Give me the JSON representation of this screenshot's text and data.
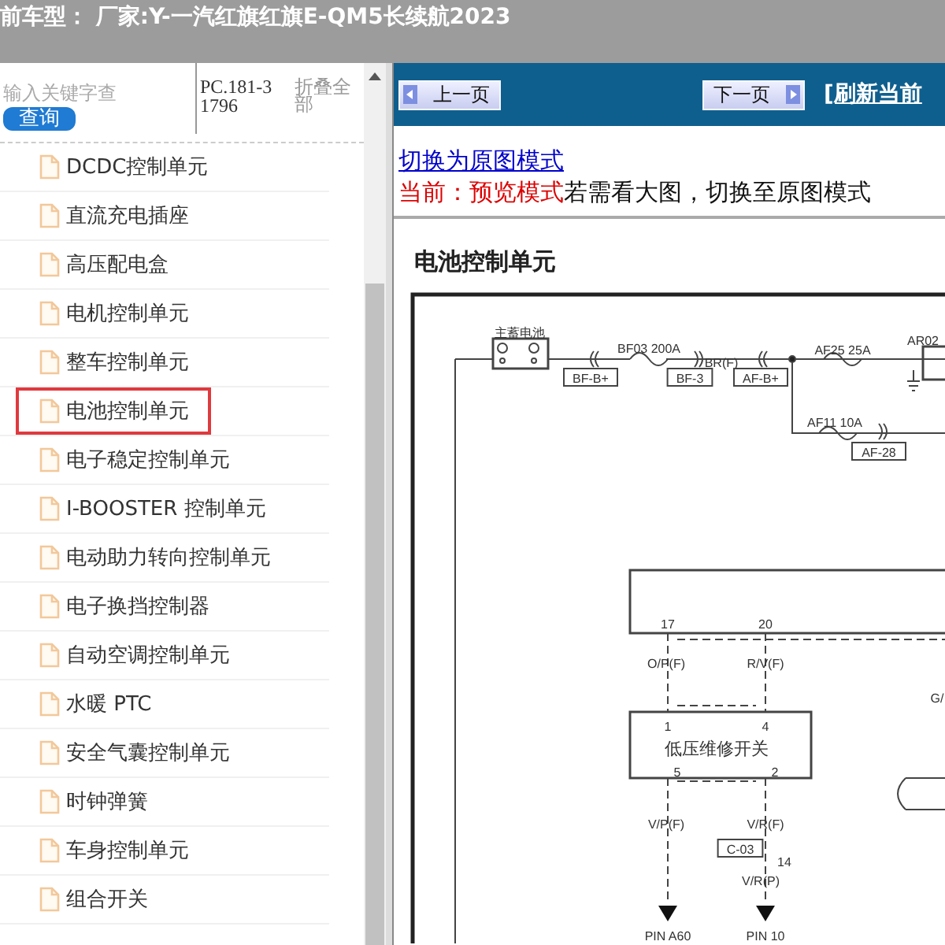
{
  "header": {
    "title": "前车型： 厂家:Y-一汽红旗红旗E-QM5长续航2023"
  },
  "sidebar": {
    "search": {
      "placeholder": "输入关键字查"
    },
    "search_button": "查询",
    "code": "PC.181-31796",
    "collapse_link": "折叠全部",
    "items": [
      {
        "label": "DCDC控制单元",
        "selected": false
      },
      {
        "label": "直流充电插座",
        "selected": false
      },
      {
        "label": "高压配电盒",
        "selected": false
      },
      {
        "label": "电机控制单元",
        "selected": false
      },
      {
        "label": "整车控制单元",
        "selected": false
      },
      {
        "label": "电池控制单元",
        "selected": true
      },
      {
        "label": "电子稳定控制单元",
        "selected": false
      },
      {
        "label": "I-BOOSTER 控制单元",
        "selected": false
      },
      {
        "label": "电动助力转向控制单元",
        "selected": false
      },
      {
        "label": "电子换挡控制器",
        "selected": false
      },
      {
        "label": "自动空调控制单元",
        "selected": false
      },
      {
        "label": "水暖 PTC",
        "selected": false
      },
      {
        "label": "安全气囊控制单元",
        "selected": false
      },
      {
        "label": "时钟弹簧",
        "selected": false
      },
      {
        "label": "车身控制单元",
        "selected": false
      },
      {
        "label": "组合开关",
        "selected": false
      }
    ]
  },
  "toolbar": {
    "prev_button": "上一页",
    "next_button": "下一页",
    "refresh_link": "[刷新当前"
  },
  "mode_switch_link": "切换为原图模式",
  "mode_notice": {
    "current": "当前：预览模式",
    "hint": "若需看大图，切换至原图模式"
  },
  "section_title": "电池控制单元",
  "diagram": {
    "labels": [
      {
        "kind": "text",
        "text": "主蓄电池"
      },
      {
        "kind": "text",
        "text": "BF03 200A"
      },
      {
        "kind": "tag",
        "text": "BF-B+"
      },
      {
        "kind": "tag",
        "text": "BF-3"
      },
      {
        "kind": "text",
        "text": "BR(F)"
      },
      {
        "kind": "tag",
        "text": "AF-B+"
      },
      {
        "kind": "text",
        "text": "AF25 25A"
      },
      {
        "kind": "text",
        "text": "AR02"
      },
      {
        "kind": "text",
        "text": "AF11 10A"
      },
      {
        "kind": "tag",
        "text": "AF-28"
      },
      {
        "kind": "text",
        "text": "17"
      },
      {
        "kind": "text",
        "text": "20"
      },
      {
        "kind": "text",
        "text": "O/P(F)"
      },
      {
        "kind": "text",
        "text": "R/V(F)"
      },
      {
        "kind": "text",
        "text": "G/"
      },
      {
        "kind": "text",
        "text": "1"
      },
      {
        "kind": "text",
        "text": "4"
      },
      {
        "kind": "text",
        "text": "低压维修开关"
      },
      {
        "kind": "text",
        "text": "5"
      },
      {
        "kind": "text",
        "text": "2"
      },
      {
        "kind": "text",
        "text": "V/P(F)"
      },
      {
        "kind": "text",
        "text": "V/R(F)"
      },
      {
        "kind": "tag",
        "text": "C-03"
      },
      {
        "kind": "text",
        "text": "14"
      },
      {
        "kind": "text",
        "text": "V/R(P)"
      },
      {
        "kind": "text",
        "text": "PIN A60"
      },
      {
        "kind": "text",
        "text": "PIN 10"
      }
    ]
  }
}
